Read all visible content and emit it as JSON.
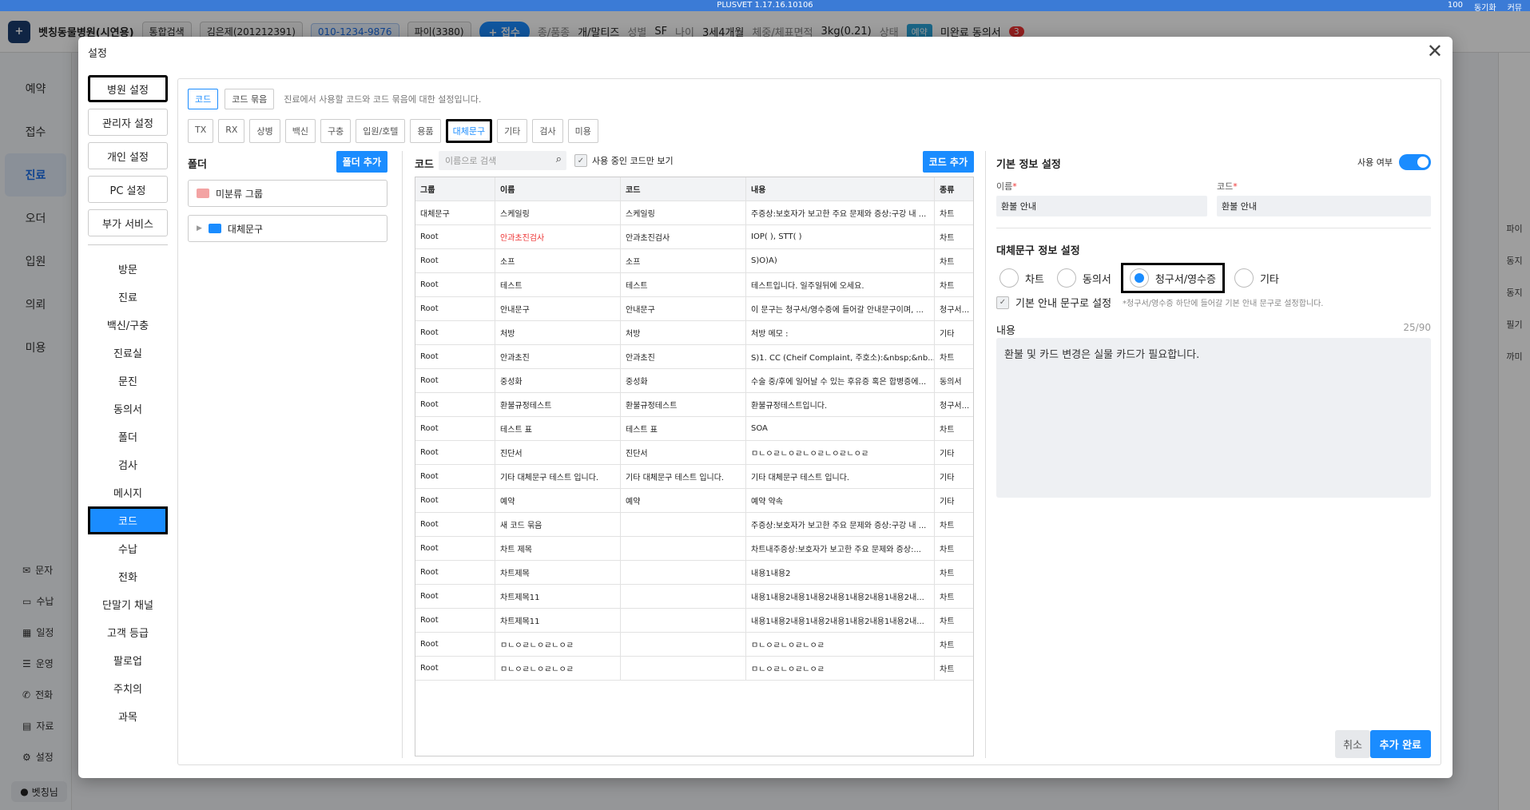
{
  "topbar": {
    "product": "PLUSVET 1.17.16.10106",
    "zoom": "100",
    "links": [
      "동기화",
      "커뮤",
      "커뮤"
    ]
  },
  "appbar": {
    "hospital": "벳칭동물병원(시연용)",
    "search_mode": "통합검색",
    "patient": "김은제(201212391)",
    "phone": "010-1234-9876",
    "pet": "파이(3380)",
    "receipt_btn": "+ 접수",
    "species_label": "종/품종",
    "species": "개/말티즈",
    "sex_label": "성별",
    "sex": "SF",
    "age_label": "나이",
    "age": "3세4개월",
    "weight_label": "체중/체표면적",
    "weight": "3kg(0.21)",
    "status_label": "상태",
    "status": "예약",
    "consent": "미완료 동의서",
    "consent_count": "3"
  },
  "leftnav": {
    "items": [
      "예약",
      "접수",
      "진료",
      "오더",
      "입원",
      "의뢰",
      "미용"
    ],
    "active": "진료",
    "subitems": [
      "문자",
      "수납",
      "일정",
      "운영",
      "전화",
      "자료",
      "설정"
    ],
    "user": "벳칭님"
  },
  "rightstrip": {
    "items": [
      "파이",
      "동지",
      "동지",
      "필기",
      "까미"
    ]
  },
  "modal": {
    "title": "설정",
    "categories": [
      "병원 설정",
      "관리자 설정",
      "개인 설정",
      "PC 설정",
      "부가 서비스"
    ],
    "selected_category": "병원 설정",
    "subitems": [
      "방문",
      "진료",
      "백신/구충",
      "진료실",
      "문진",
      "동의서",
      "폴더",
      "검사",
      "메시지",
      "코드",
      "수납",
      "전화",
      "단말기 채널",
      "고객 등급",
      "팔로업",
      "주치의",
      "과목"
    ],
    "selected_subitem": "코드",
    "tabs": [
      "코드",
      "코드 묶음"
    ],
    "tab_hint": "진료에서 사용할 코드와 코드 묶음에 대한 설정입니다.",
    "code_categories": [
      "TX",
      "RX",
      "상병",
      "백신",
      "구충",
      "입원/호텔",
      "용품",
      "대체문구",
      "기타",
      "검사",
      "미용"
    ],
    "selected_code_category": "대체문구",
    "folder": {
      "title": "폴더",
      "add_btn": "폴더 추가",
      "items": [
        {
          "label": "미분류 그룹",
          "color": "#f3a3a3"
        },
        {
          "label": "대체문구",
          "color": "#1a8cff"
        }
      ]
    },
    "code": {
      "title": "코드",
      "search_placeholder": "이름으로 검색",
      "only_active": "사용 중인 코드만 보기",
      "add_btn": "코드 추가",
      "columns": [
        "그룹",
        "이름",
        "코드",
        "내용",
        "종류"
      ],
      "rows": [
        [
          "대체문구",
          "스케일링",
          "스케일링",
          "주증상:보호자가 보고한 주요 문제와 증상:구강 내 ...",
          "차트"
        ],
        [
          "Root",
          "안과초진검사",
          "안과초진검사",
          "IOP( ), STT( )",
          "차트"
        ],
        [
          "Root",
          "소프",
          "소프",
          "S)O)A)",
          "차트"
        ],
        [
          "Root",
          "테스트",
          "테스트",
          "테스트입니다. 일주일뒤에 오세요.",
          "차트"
        ],
        [
          "Root",
          "안내문구",
          "안내문구",
          "이 문구는 청구서/영수증에 들어갈 안내문구이며, ...",
          "청구서..."
        ],
        [
          "Root",
          "처방",
          "처방",
          "처방 메모 :",
          "기타"
        ],
        [
          "Root",
          "안과초진",
          "안과초진",
          "S)1. CC (Cheif Complaint, 주호소):&nbsp;&nb...",
          "차트"
        ],
        [
          "Root",
          "중성화",
          "중성화",
          "수술 중/후에 일어날 수 있는 후유증 혹은 합병증에...",
          "동의서"
        ],
        [
          "Root",
          "환불규정테스트",
          "환불규정테스트",
          "환불규정테스트입니다.",
          "청구서..."
        ],
        [
          "Root",
          "테스트 표",
          "테스트 표",
          "SOA",
          "차트"
        ],
        [
          "Root",
          "진단서",
          "진단서",
          "ㅁㄴㅇㄹㄴㅇㄹㄴㅇㄹㄴㅇㄹㄴㅇㄹ",
          "기타"
        ],
        [
          "Root",
          "기타 대체문구 테스트 입니다.",
          "기타 대체문구 테스트 입니다.",
          "기타 대체문구 테스트 입니다.",
          "기타"
        ],
        [
          "Root",
          "예약",
          "예약",
          "예약 약속",
          "기타"
        ],
        [
          "Root",
          "새 코드 묶음",
          "",
          "주증상:보호자가 보고한 주요 문제와 증상:구강 내 ...",
          "차트"
        ],
        [
          "Root",
          "차트 제목",
          "",
          "차트내주증상:보호자가 보고한 주요 문제와 증상:...",
          "차트"
        ],
        [
          "Root",
          "차트제목",
          "",
          "내용1내용2",
          "차트"
        ],
        [
          "Root",
          "차트제목11",
          "",
          "내용1내용2내용1내용2내용1내용2내용1내용2내...",
          "차트"
        ],
        [
          "Root",
          "차트제목11",
          "",
          "내용1내용2내용1내용2내용1내용2내용1내용2내...",
          "차트"
        ],
        [
          "Root",
          "ㅁㄴㅇㄹㄴㅇㄹㄴㅇㄹ",
          "",
          "ㅁㄴㅇㄹㄴㅇㄹㄴㅇㄹ",
          "차트"
        ],
        [
          "Root",
          "ㅁㄴㅇㄹㄴㅇㄹㄴㅇㄹ",
          "",
          "ㅁㄴㅇㄹㄴㅇㄹㄴㅇㄹ",
          "차트"
        ]
      ]
    },
    "detail": {
      "title": "기본 정보 설정",
      "use_label": "사용 여부",
      "name_label": "이름",
      "name_value": "환불 안내",
      "code_label": "코드",
      "code_value": "환불 안내",
      "subtitle": "대체문구 정보 설정",
      "radio_options": [
        "차트",
        "동의서",
        "청구서/영수증",
        "기타"
      ],
      "selected_radio": "청구서/영수증",
      "default_label": "기본 안내 문구로 설정",
      "default_hint": "*청구서/영수증 하단에 들어갈 기본 안내 문구로 설정합니다.",
      "content_label": "내용",
      "content_count": "25/90",
      "content_value": "환불 및 카드 변경은 실물 카드가 필요합니다.",
      "cancel_btn": "취소",
      "confirm_btn": "추가 완료"
    }
  }
}
